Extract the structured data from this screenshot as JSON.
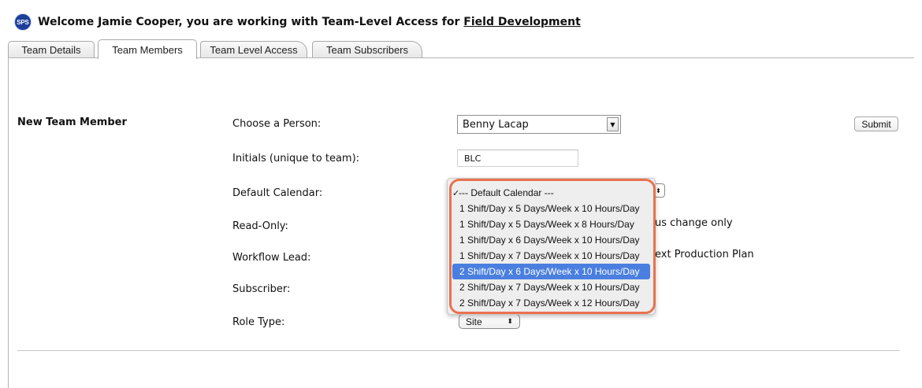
{
  "header": {
    "logo": "SPS",
    "welcome_prefix": "Welcome Jamie Cooper, you are working with Team-Level Access for ",
    "team_link": "Field Development"
  },
  "tabs": [
    {
      "label": "Team Details",
      "active": false
    },
    {
      "label": "Team Members",
      "active": true
    },
    {
      "label": "Team Level Access",
      "active": false
    },
    {
      "label": "Team Subscribers",
      "active": false
    }
  ],
  "form": {
    "section_title": "New Team Member",
    "labels": {
      "person": "Choose a Person:",
      "initials": "Initials (unique to team):",
      "calendar": "Default Calendar:",
      "readonly": "Read-Only:",
      "workflow": "Workflow Lead:",
      "subscriber": "Subscriber:",
      "role": "Role Type:"
    },
    "person_value": "Benny Lacap",
    "initials_value": "BLC",
    "submit_label": "Submit",
    "readonly_option_text": "us change only",
    "workflow_option_text": "ext Production Plan",
    "role_value": "Site"
  },
  "calendar_dropdown": {
    "selected_index": 5,
    "checked_index": 0,
    "options": [
      "--- Default Calendar ---",
      "1 Shift/Day x 5 Days/Week x 10 Hours/Day",
      "1 Shift/Day x 5 Days/Week x 8 Hours/Day",
      "1 Shift/Day x 6 Days/Week x 10 Hours/Day",
      "1 Shift/Day x 7 Days/Week x 10 Hours/Day",
      "2 Shift/Day x 6 Days/Week x 10 Hours/Day",
      "2 Shift/Day x 7 Days/Week x 10 Hours/Day",
      "2 Shift/Day x 7 Days/Week x 12 Hours/Day"
    ]
  },
  "colors": {
    "accent_ring": "#e8724f",
    "selection": "#4a7fe0",
    "logo_bg": "#1d3f9a"
  }
}
